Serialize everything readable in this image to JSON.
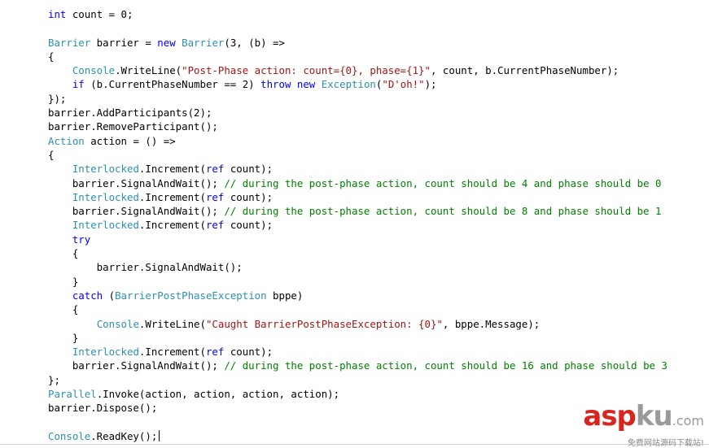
{
  "editor": {
    "lines": [
      [
        {
          "t": "int",
          "c": "kw"
        },
        {
          "t": " count = 0;",
          "c": "tx"
        }
      ],
      [],
      [
        {
          "t": "Barrier",
          "c": "ty"
        },
        {
          "t": " barrier = ",
          "c": "tx"
        },
        {
          "t": "new",
          "c": "kw"
        },
        {
          "t": " ",
          "c": "tx"
        },
        {
          "t": "Barrier",
          "c": "ty"
        },
        {
          "t": "(3, (b) =>",
          "c": "tx"
        }
      ],
      [
        {
          "t": "{",
          "c": "tx"
        }
      ],
      [
        {
          "t": "    ",
          "c": "tx"
        },
        {
          "t": "Console",
          "c": "ty"
        },
        {
          "t": ".WriteLine(",
          "c": "tx"
        },
        {
          "t": "\"Post-Phase action: count={0}, phase={1}\"",
          "c": "st"
        },
        {
          "t": ", count, b.CurrentPhaseNumber);",
          "c": "tx"
        }
      ],
      [
        {
          "t": "    ",
          "c": "tx"
        },
        {
          "t": "if",
          "c": "kw"
        },
        {
          "t": " (b.CurrentPhaseNumber == 2) ",
          "c": "tx"
        },
        {
          "t": "throw",
          "c": "kw"
        },
        {
          "t": " ",
          "c": "tx"
        },
        {
          "t": "new",
          "c": "kw"
        },
        {
          "t": " ",
          "c": "tx"
        },
        {
          "t": "Exception",
          "c": "ty"
        },
        {
          "t": "(",
          "c": "tx"
        },
        {
          "t": "\"D'oh!\"",
          "c": "st"
        },
        {
          "t": ");",
          "c": "tx"
        }
      ],
      [
        {
          "t": "});",
          "c": "tx"
        }
      ],
      [
        {
          "t": "barrier.AddParticipants(2);",
          "c": "tx"
        }
      ],
      [
        {
          "t": "barrier.RemoveParticipant();",
          "c": "tx"
        }
      ],
      [
        {
          "t": "Action",
          "c": "ty"
        },
        {
          "t": " action = () =>",
          "c": "tx"
        }
      ],
      [
        {
          "t": "{",
          "c": "tx"
        }
      ],
      [
        {
          "t": "    ",
          "c": "tx"
        },
        {
          "t": "Interlocked",
          "c": "ty"
        },
        {
          "t": ".Increment(",
          "c": "tx"
        },
        {
          "t": "ref",
          "c": "kw"
        },
        {
          "t": " count);",
          "c": "tx"
        }
      ],
      [
        {
          "t": "    barrier.SignalAndWait(); ",
          "c": "tx"
        },
        {
          "t": "// during the post-phase action, count should be 4 and phase should be 0",
          "c": "cm"
        }
      ],
      [
        {
          "t": "    ",
          "c": "tx"
        },
        {
          "t": "Interlocked",
          "c": "ty"
        },
        {
          "t": ".Increment(",
          "c": "tx"
        },
        {
          "t": "ref",
          "c": "kw"
        },
        {
          "t": " count);",
          "c": "tx"
        }
      ],
      [
        {
          "t": "    barrier.SignalAndWait(); ",
          "c": "tx"
        },
        {
          "t": "// during the post-phase action, count should be 8 and phase should be 1",
          "c": "cm"
        }
      ],
      [
        {
          "t": "    ",
          "c": "tx"
        },
        {
          "t": "Interlocked",
          "c": "ty"
        },
        {
          "t": ".Increment(",
          "c": "tx"
        },
        {
          "t": "ref",
          "c": "kw"
        },
        {
          "t": " count);",
          "c": "tx"
        }
      ],
      [
        {
          "t": "    ",
          "c": "tx"
        },
        {
          "t": "try",
          "c": "kw"
        }
      ],
      [
        {
          "t": "    {",
          "c": "tx"
        }
      ],
      [
        {
          "t": "        barrier.SignalAndWait();",
          "c": "tx"
        }
      ],
      [
        {
          "t": "    }",
          "c": "tx"
        }
      ],
      [
        {
          "t": "    ",
          "c": "tx"
        },
        {
          "t": "catch",
          "c": "kw"
        },
        {
          "t": " (",
          "c": "tx"
        },
        {
          "t": "BarrierPostPhaseException",
          "c": "ty"
        },
        {
          "t": " bppe)",
          "c": "tx"
        }
      ],
      [
        {
          "t": "    {",
          "c": "tx"
        }
      ],
      [
        {
          "t": "        ",
          "c": "tx"
        },
        {
          "t": "Console",
          "c": "ty"
        },
        {
          "t": ".WriteLine(",
          "c": "tx"
        },
        {
          "t": "\"Caught BarrierPostPhaseException: {0}\"",
          "c": "st"
        },
        {
          "t": ", bppe.Message);",
          "c": "tx"
        }
      ],
      [
        {
          "t": "    }",
          "c": "tx"
        }
      ],
      [
        {
          "t": "    ",
          "c": "tx"
        },
        {
          "t": "Interlocked",
          "c": "ty"
        },
        {
          "t": ".Increment(",
          "c": "tx"
        },
        {
          "t": "ref",
          "c": "kw"
        },
        {
          "t": " count);",
          "c": "tx"
        }
      ],
      [
        {
          "t": "    barrier.SignalAndWait(); ",
          "c": "tx"
        },
        {
          "t": "// during the post-phase action, count should be 16 and phase should be 3",
          "c": "cm"
        }
      ],
      [
        {
          "t": "};",
          "c": "tx"
        }
      ],
      [
        {
          "t": "Parallel",
          "c": "ty"
        },
        {
          "t": ".Invoke(action, action, action, action);",
          "c": "tx"
        }
      ],
      [
        {
          "t": "barrier.Dispose();",
          "c": "tx"
        }
      ],
      [],
      [
        {
          "t": "Console",
          "c": "ty"
        },
        {
          "t": ".ReadKey();",
          "c": "tx"
        }
      ]
    ],
    "caret_line": 30,
    "colors": {
      "keyword": "#0000ff",
      "type": "#2b91af",
      "string": "#a31515",
      "comment": "#008000",
      "text": "#000000"
    }
  },
  "watermark": {
    "logo_main": "asp",
    "logo_ku": "ku",
    "logo_domain": ".com",
    "tagline": "免费网站源码下载站!"
  }
}
